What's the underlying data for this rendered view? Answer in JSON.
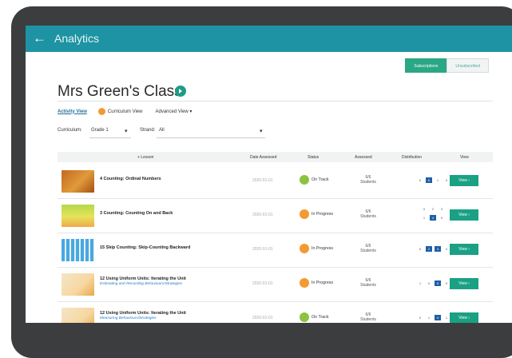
{
  "header": {
    "title": "Analytics"
  },
  "toggle": {
    "left": "Subscriptions",
    "right": "Unsubscribed"
  },
  "class_title": "Mrs Green's Class",
  "views": {
    "activity": "Activity View",
    "curriculum": "Curriculum View",
    "advanced": "Advanced View ▾"
  },
  "filters": {
    "curriculum_label": "Curriculum:",
    "curriculum_value": "Grade 1",
    "strand_label": "Strand:",
    "strand_value": "All"
  },
  "table": {
    "headers": {
      "lesson": "+ Lesson",
      "date": "Date Assessed",
      "status": "Status",
      "assessed": "Assessed",
      "distribution": "Distribution",
      "view": "View"
    },
    "rows": [
      {
        "lesson": "4 Counting: Ordinal Numbers",
        "sub": "",
        "date": "2020-01-01",
        "status": "On Track",
        "status_color": "#8cc43f",
        "assessed": "6/6",
        "assessed_unit": "Students",
        "view": "View"
      },
      {
        "lesson": "3 Counting: Counting On and Back",
        "sub": "",
        "date": "2020-01-01",
        "status": "In Progress",
        "status_color": "#f39a32",
        "assessed": "6/6",
        "assessed_unit": "Students",
        "view": "View"
      },
      {
        "lesson": "15 Skip Counting: Skip-Counting Backward",
        "sub": "",
        "date": "2020-01-01",
        "status": "In Progress",
        "status_color": "#f39a32",
        "assessed": "6/6",
        "assessed_unit": "Students",
        "view": "View"
      },
      {
        "lesson": "12 Using Uniform Units: Iterating the Unit",
        "sub": "Estimating and Recording Behaviours/Strategies",
        "date": "2020-01-01",
        "status": "In Progress",
        "status_color": "#f39a32",
        "assessed": "6/6",
        "assessed_unit": "Students",
        "view": "View"
      },
      {
        "lesson": "12 Using Uniform Units: Iterating the Unit",
        "sub": "Measuring Behaviours/Strategies",
        "date": "2020-01-01",
        "status": "On Track",
        "status_color": "#8cc43f",
        "assessed": "6/6",
        "assessed_unit": "Students",
        "view": "View"
      }
    ]
  },
  "icons": {
    "back": "back-arrow-icon",
    "title_badge": "play-circle-icon",
    "status_ok": "check-circle-icon",
    "status_progress": "arrow-circle-icon"
  },
  "colors": {
    "header": "#1d93a3",
    "button": "#1aa184",
    "on_track": "#8cc43f",
    "in_progress": "#f39a32",
    "dist_on": "#1f5fa8"
  }
}
